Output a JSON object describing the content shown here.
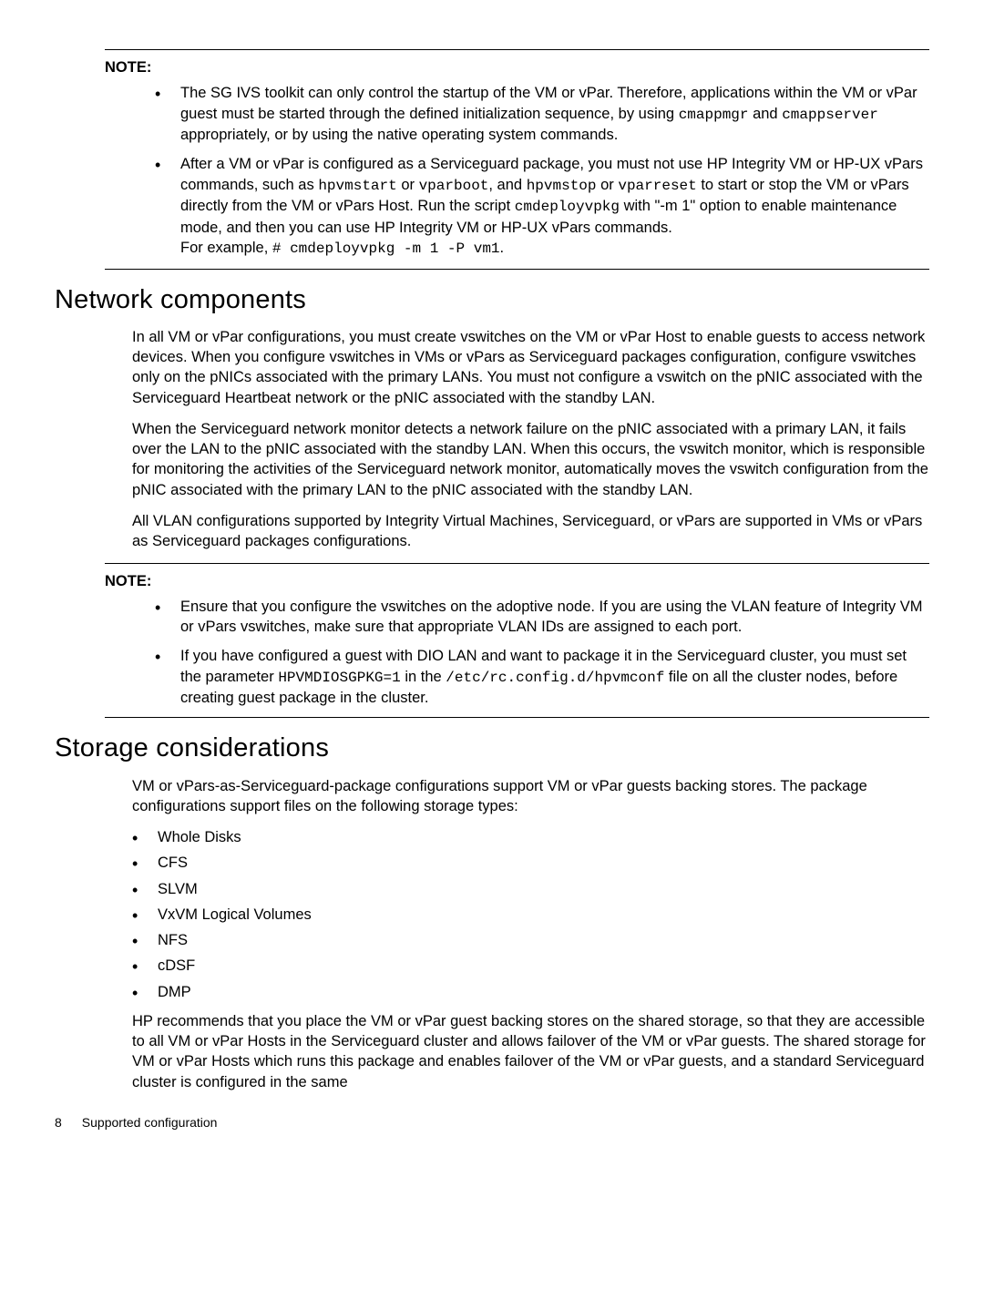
{
  "note1": {
    "label": "NOTE:",
    "items": [
      "The SG IVS toolkit can only control the startup of the VM or vPar. Therefore, applications within the VM or vPar guest must be started through the defined initialization sequence, by using <span class=\"code\">cmappmgr</span> and <span class=\"code\">cmappserver</span> appropriately, or by using the native operating system commands.",
      "After a VM or vPar is configured as a Serviceguard package, you must not use HP Integrity VM or HP-UX vPars commands, such as <span class=\"code\">hpvmstart</span> or <span class=\"code\">vparboot</span>, and <span class=\"code\">hpvmstop</span> or <span class=\"code\">vparreset</span> to start or stop the VM or vPars directly from the VM or vPars Host. Run the script <span class=\"code\">cmdeployvpkg</span> with \"-m 1\" option to enable maintenance mode, and then you can use HP Integrity VM or HP-UX vPars commands.<br>For example, <span class=\"code\"># cmdeployvpkg -m 1 -P vm1</span>."
    ]
  },
  "section1": {
    "heading": "Network components",
    "p1": "In all VM or vPar configurations, you must create vswitches on the VM or vPar Host to enable guests to access network devices. When you configure vswitches in VMs or vPars as Serviceguard packages configuration, configure vswitches only on the pNICs associated with the primary LANs. You must not configure a vswitch on the pNIC associated with the Serviceguard Heartbeat network or the pNIC associated with the standby LAN.",
    "p2": "When the Serviceguard network monitor detects a network failure on the pNIC associated with a primary LAN, it fails over the LAN to the pNIC associated with the standby LAN. When this occurs, the vswitch monitor, which is responsible for monitoring the activities of the Serviceguard network monitor, automatically moves the vswitch configuration from the pNIC associated with the primary LAN to the pNIC associated with the standby LAN.",
    "p3": "All VLAN configurations supported by Integrity Virtual Machines, Serviceguard, or vPars are supported in VMs or vPars as Serviceguard packages configurations."
  },
  "note2": {
    "label": "NOTE:",
    "items": [
      "Ensure that you configure the vswitches on the adoptive node. If you are using the VLAN feature of Integrity VM or vPars vswitches, make sure that appropriate VLAN IDs are assigned to each port.",
      "If you have configured a guest with DIO LAN and want to package it in the Serviceguard cluster, you must set the parameter <span class=\"code\">HPVMDIOSGPKG=1</span> in the <span class=\"code\">/etc/rc.config.d/hpvmconf</span> file on all the cluster nodes, before creating guest package in the cluster."
    ]
  },
  "section2": {
    "heading": "Storage considerations",
    "p1": "VM or vPars-as-Serviceguard-package configurations support VM or vPar guests backing stores. The package configurations support files on the following storage types:",
    "list": [
      "Whole Disks",
      "CFS",
      "SLVM",
      "VxVM Logical Volumes",
      "NFS",
      "cDSF",
      "DMP"
    ],
    "p2": "HP recommends that you place the VM or vPar guest backing stores on the shared storage, so that they are accessible to all VM or vPar Hosts in the Serviceguard cluster and allows failover of the VM or vPar guests. The shared storage for VM or vPar Hosts which runs this package and enables failover of the VM or vPar guests, and a standard Serviceguard cluster is configured in the same"
  },
  "footer": {
    "pageno": "8",
    "section": "Supported configuration"
  }
}
